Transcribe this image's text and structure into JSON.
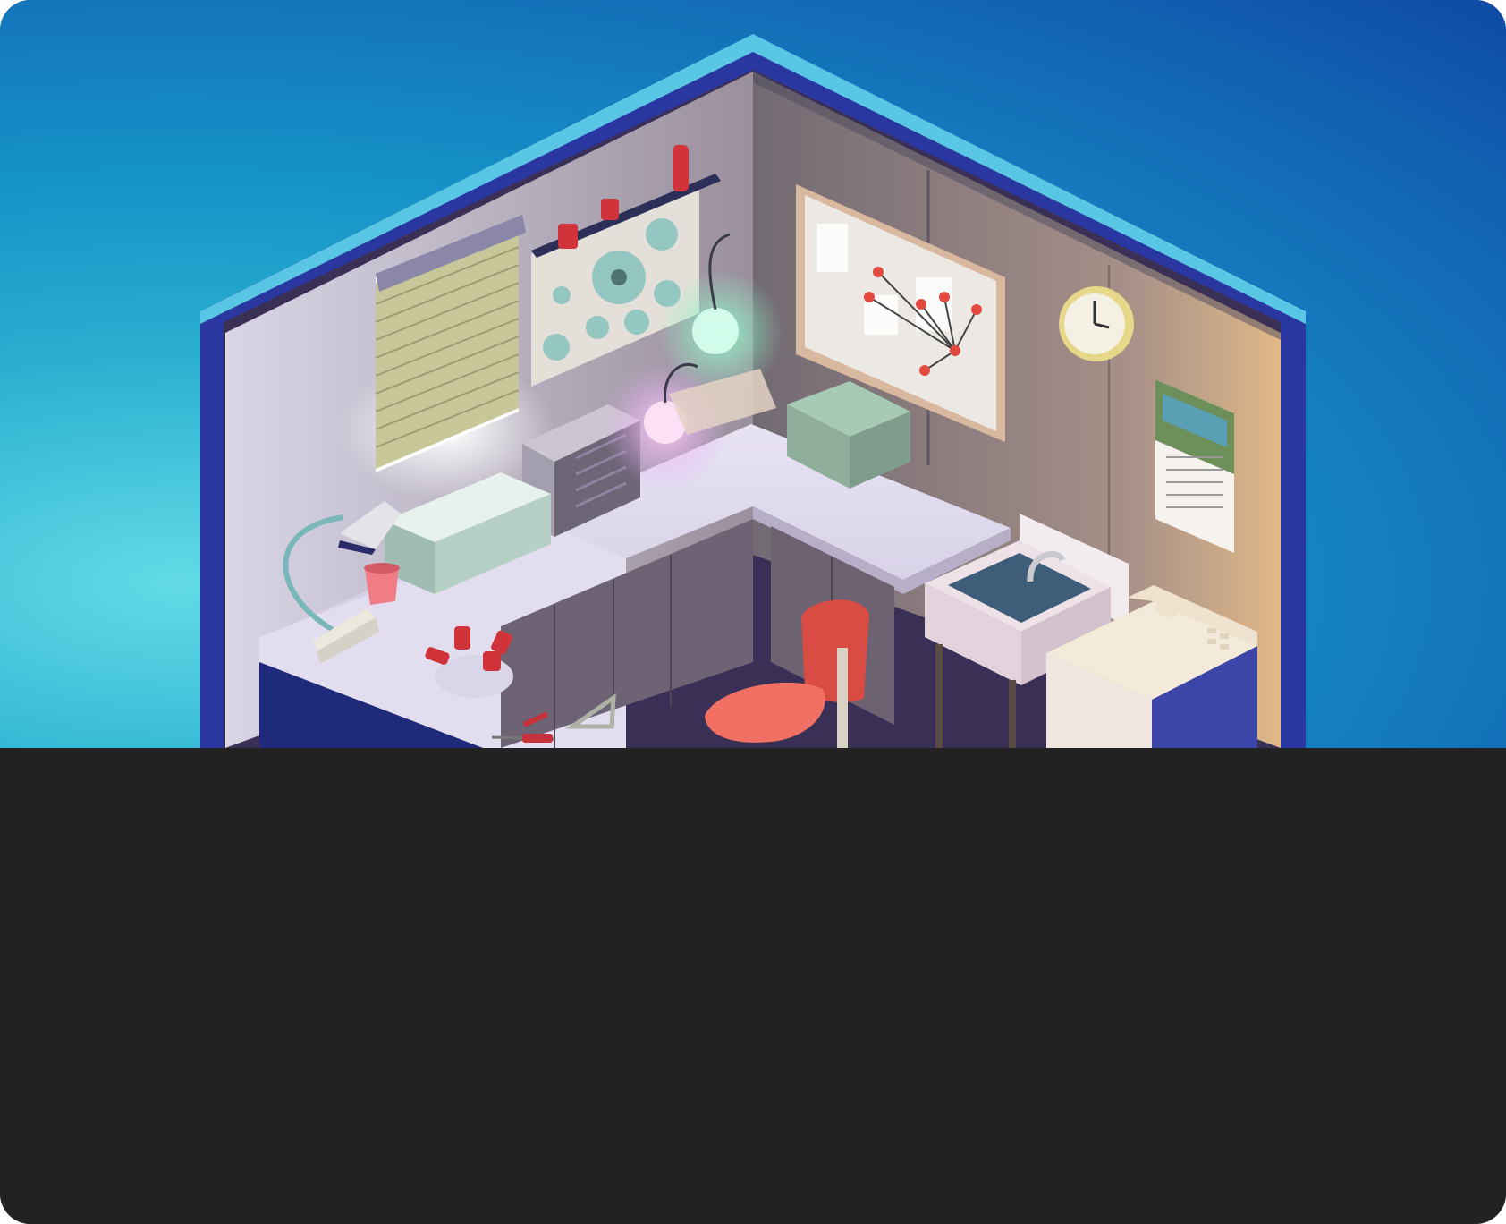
{
  "illustration": {
    "subject": "lab-room-illustration",
    "colors": {
      "sky_accent": "#1592c7",
      "frame": "#2f3fa8",
      "frame_top": "#4cc3e0",
      "panel_background": "#222222",
      "chair": "#e9564e"
    }
  }
}
